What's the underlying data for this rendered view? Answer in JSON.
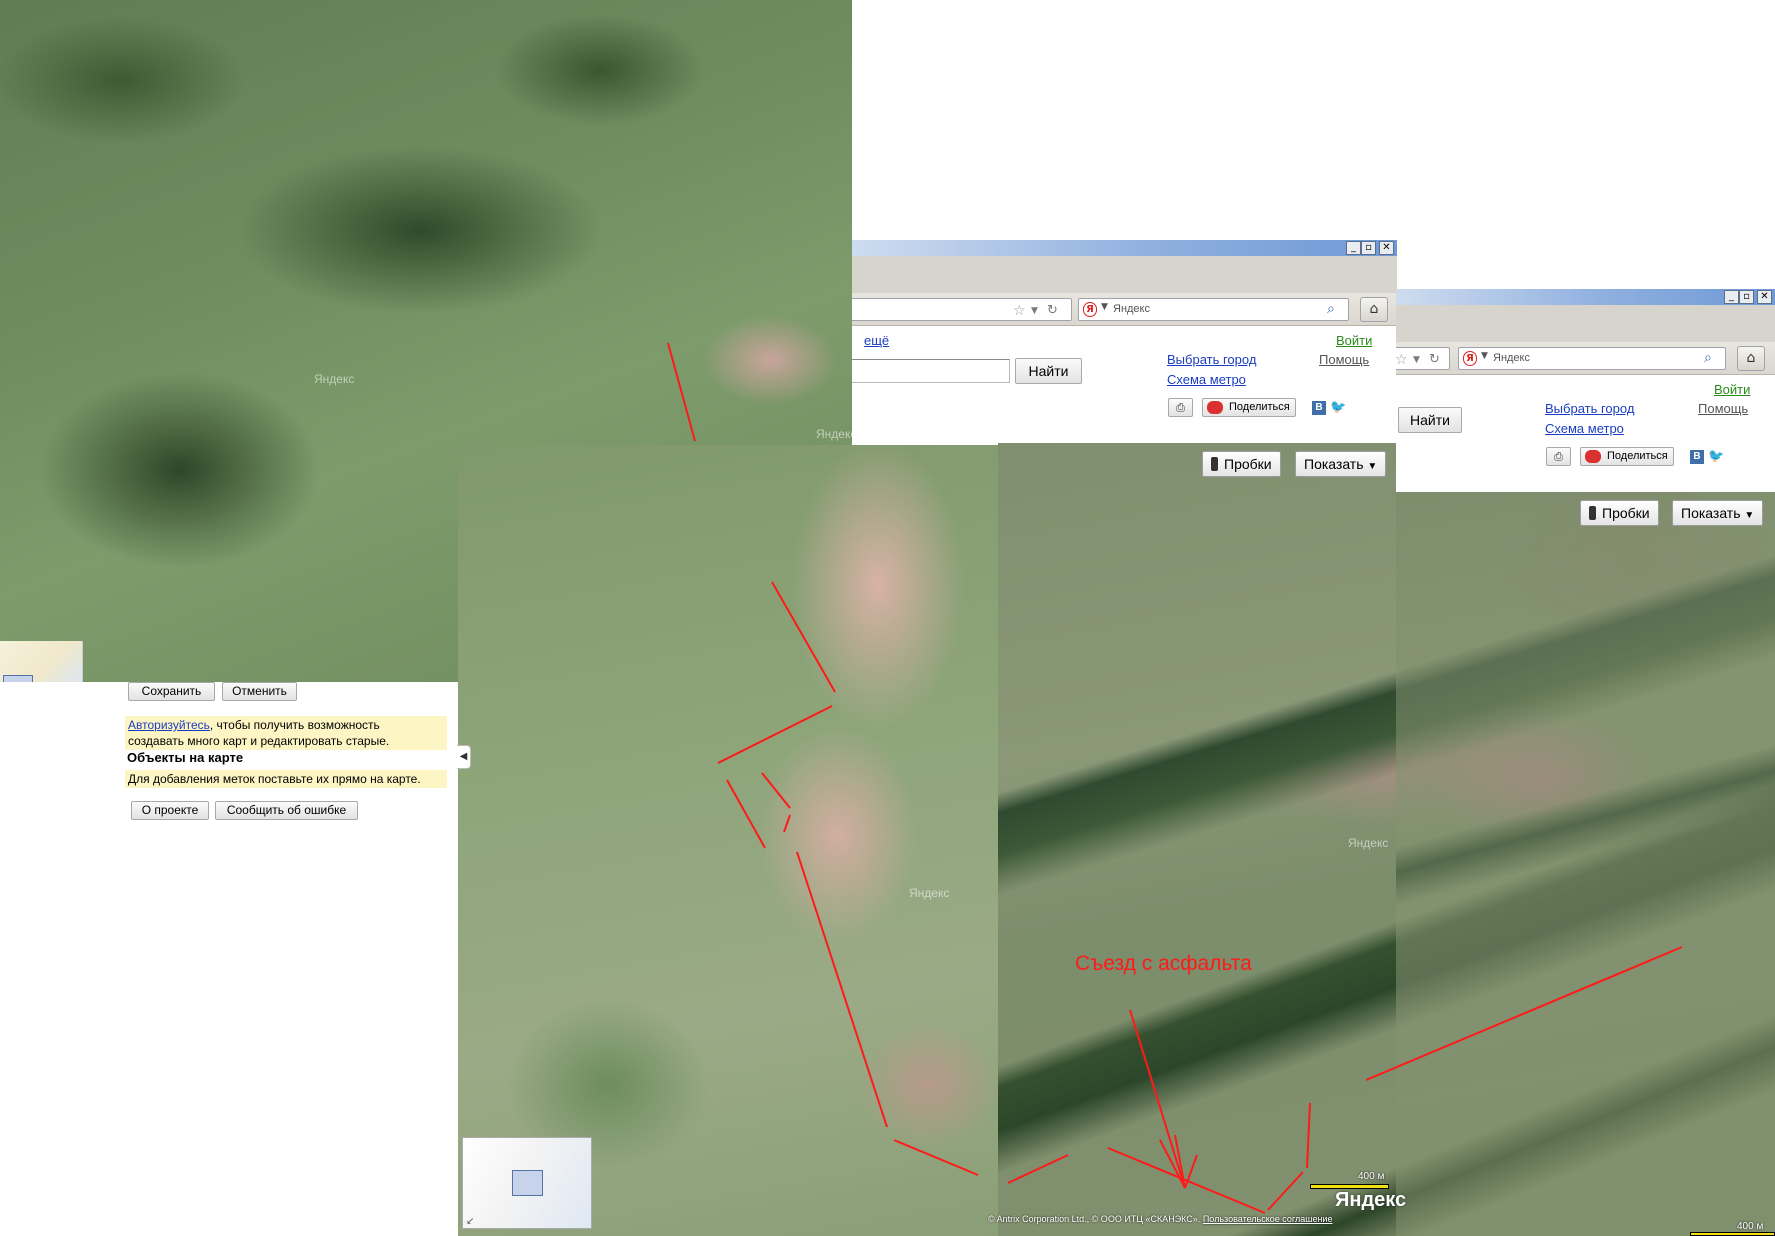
{
  "map": {
    "watermark": "Яндекс",
    "road_label": "Съезд с асфальта",
    "scale_label": "400 м",
    "logo": "Яндекс",
    "copyright_text": "© Antrix Corporation Ltd., © ООО ИТЦ «СКАНЭКС»",
    "terms_link": "Пользовательское соглашение",
    "line_color": "#ff1a1a"
  },
  "window1": {
    "title_buttons": [
      "_",
      "▫",
      "✕"
    ],
    "search_engine": "Яндекс",
    "link_more": "ещё",
    "link_login": "Войти",
    "link_choose_city": "Выбрать город",
    "link_help": "Помощь",
    "link_metro": "Схема метро",
    "find_button": "Найти",
    "share_button": "Поделиться",
    "vk_label": "В",
    "traffic_button": "Пробки",
    "show_button": "Показать"
  },
  "window2": {
    "title_buttons": [
      "_",
      "▫",
      "✕"
    ],
    "search_engine": "Яндекс",
    "link_login": "Войти",
    "link_choose_city": "Выбрать город",
    "link_help": "Помощь",
    "link_metro": "Схема метро",
    "find_button": "Найти",
    "share_button": "Поделиться",
    "vk_label": "В",
    "traffic_button": "Пробки",
    "show_button": "Показать"
  },
  "panel": {
    "save_button": "Сохранить",
    "cancel_button": "Отменить",
    "auth_link": "Авторизуйтесь",
    "auth_text_line1": ", чтобы получить возможность",
    "auth_text_line2": "создавать много карт и редактировать старые.",
    "objects_title": "Объекты на карте",
    "objects_hint": "Для добавления меток поставьте их прямо на карте.",
    "about_button": "О проекте",
    "report_button": "Сообщить об ошибке"
  }
}
